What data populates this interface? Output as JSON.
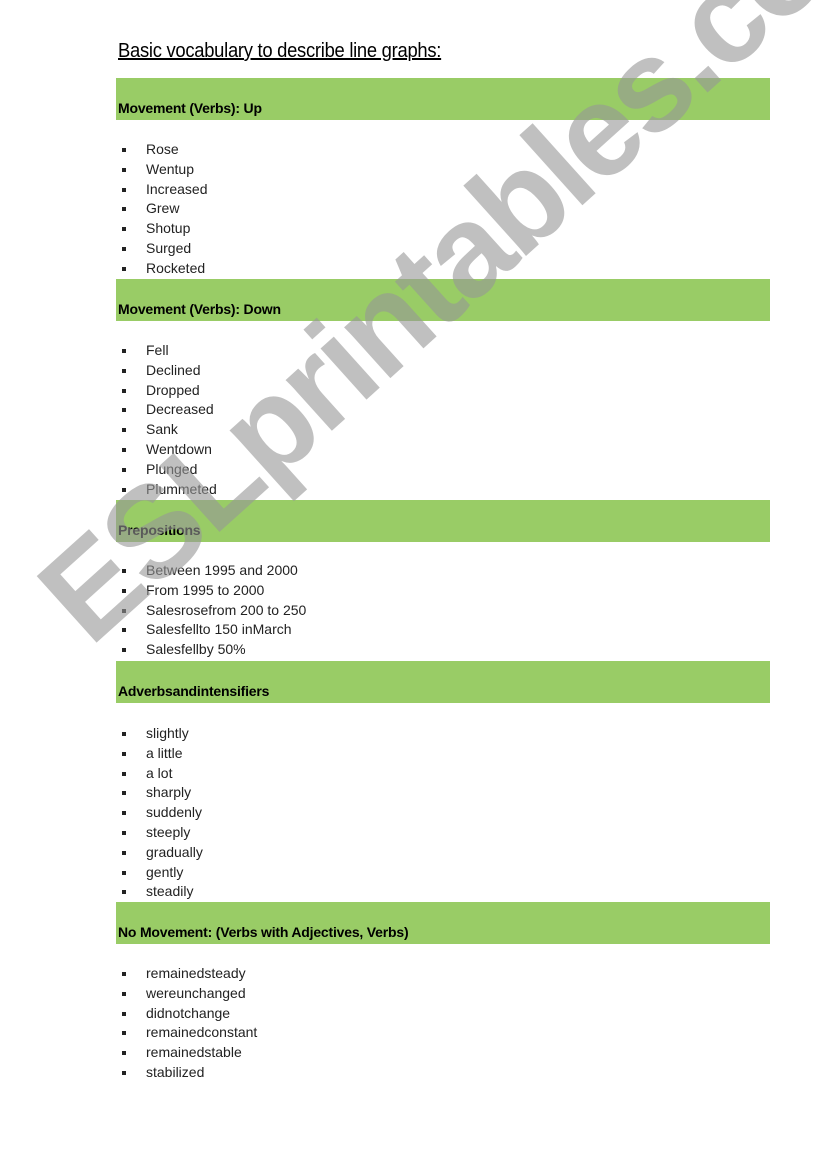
{
  "title": "Basic vocabulary to describe line graphs:",
  "accent_color": "#99cc66",
  "watermark": "ESLprintables.com",
  "sections": [
    {
      "heading": "Movement (Verbs): Up",
      "items": [
        "Rose",
        "Wentup",
        "Increased",
        "Grew",
        "Shotup",
        "Surged",
        "Rocketed"
      ]
    },
    {
      "heading": "Movement (Verbs): Down",
      "items": [
        "Fell",
        "Declined",
        "Dropped",
        "Decreased",
        "Sank",
        "Wentdown",
        "Plunged",
        "Plummeted"
      ]
    },
    {
      "heading": "Prepositions",
      "items": [
        "Between 1995 and 2000",
        "From 1995 to 2000",
        "Salesrosefrom 200 to 250",
        "Salesfellto 150 inMarch",
        "Salesfellby 50%"
      ]
    },
    {
      "heading": "Adverbsandintensifiers",
      "items": [
        "slightly",
        "a little",
        "a lot",
        "sharply",
        "suddenly",
        "steeply",
        "gradually",
        "gently",
        "steadily"
      ]
    },
    {
      "heading": "No Movement: (Verbs with Adjectives, Verbs)",
      "items": [
        "remainedsteady",
        "wereunchanged",
        "didnotchange",
        "remainedconstant",
        "remainedstable",
        "stabilized"
      ]
    }
  ]
}
